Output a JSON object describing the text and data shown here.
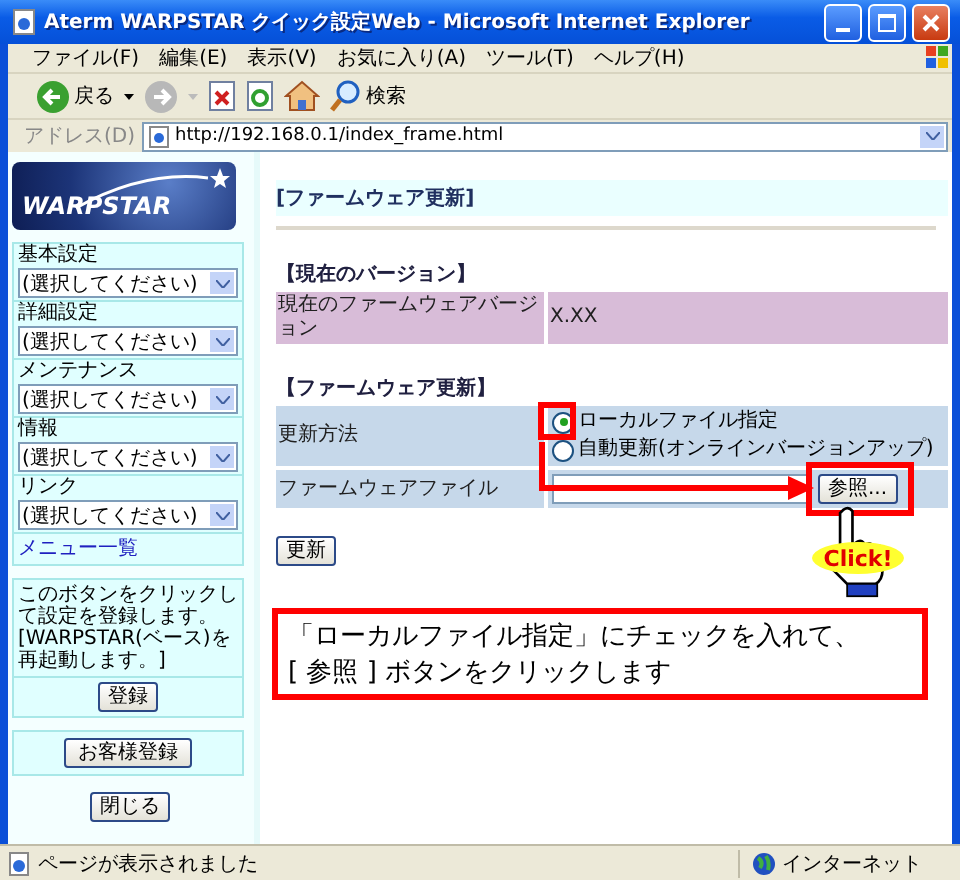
{
  "window": {
    "title": "Aterm WARPSTAR クイック設定Web - Microsoft Internet Explorer"
  },
  "menu_bar": [
    "ファイル(F)",
    "編集(E)",
    "表示(V)",
    "お気に入り(A)",
    "ツール(T)",
    "ヘルプ(H)"
  ],
  "toolbar": {
    "back": "戻る",
    "search": "検索"
  },
  "address_bar": {
    "label": "アドレス(D)",
    "url": "http://192.168.0.1/index_frame.html"
  },
  "sidebar": {
    "logo": "WARPSTAR",
    "menus": [
      {
        "label": "基本設定",
        "value": "(選択してください)"
      },
      {
        "label": "詳細設定",
        "value": "(選択してください)"
      },
      {
        "label": "メンテナンス",
        "value": "(選択してください)"
      },
      {
        "label": "情報",
        "value": "(選択してください)"
      },
      {
        "label": "リンク",
        "value": "(選択してください)"
      }
    ],
    "menu_list_link": "メニュー一覧",
    "register_note": "このボタンをクリックして設定を登録します。[WARPSTAR(ベース)を再起動します。]",
    "register_button": "登録",
    "customer_button": "お客様登録",
    "close_button": "閉じる"
  },
  "page": {
    "title": "[ファームウェア更新]",
    "version_heading": "【現在のバージョン】",
    "version_label": "現在のファームウェアバージョン",
    "version_value": "X.XX",
    "update_heading": "【ファームウェア更新】",
    "method_label": "更新方法",
    "methods": [
      {
        "label": "ローカルファイル指定",
        "selected": true,
        "highlighted": true
      },
      {
        "label": "自動更新(オンラインバージョンアップ)",
        "selected": false,
        "highlighted": false
      }
    ],
    "file_label": "ファームウェアファイル",
    "browse_button": "参照...",
    "browse_highlighted": true,
    "update_button": "更新"
  },
  "annotation": {
    "click_badge": "Click!",
    "callout": [
      "「ローカルファイル指定」にチェックを入れて、",
      "[ 参照 ] ボタンをクリックします"
    ]
  },
  "status_bar": {
    "message": "ページが表示されました",
    "zone": "インターネット"
  }
}
